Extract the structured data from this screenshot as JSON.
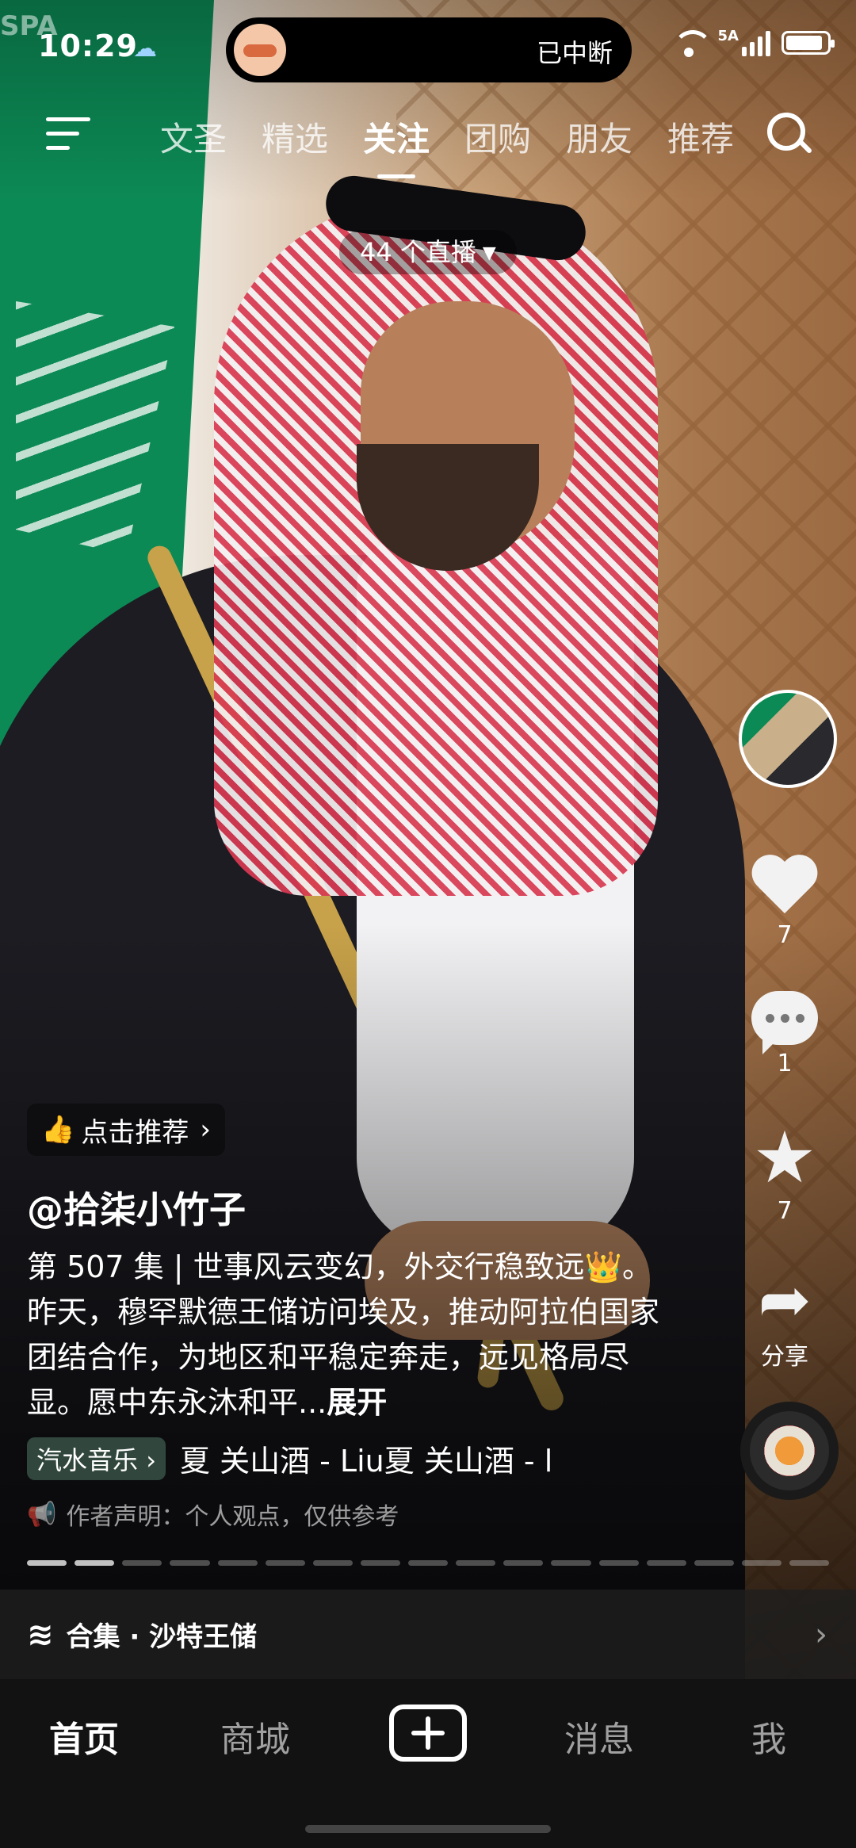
{
  "status": {
    "time": "10:29",
    "island_text": "已中断",
    "network": "5A"
  },
  "watermark": "SPA",
  "nav": {
    "tabs": [
      "文圣",
      "精选",
      "关注",
      "团购",
      "朋友",
      "推荐"
    ],
    "active_tab": "关注"
  },
  "live": {
    "label": "44 个直播"
  },
  "rail": {
    "like_count": "7",
    "comment_count": "1",
    "favorite_count": "7",
    "share_label": "分享"
  },
  "post": {
    "recommend_label": "点击推荐",
    "author": "@拾柒小竹子",
    "caption": "第 507 集 | 世事风云变幻，外交行稳致远👑。昨天，穆罕默德王储访问埃及，推动阿拉伯国家团结合作，为地区和平稳定奔走，远见格局尽显。愿中东永沐和平...",
    "expand_label": "展开",
    "music_chip": "汽水音乐",
    "music_title": "夏  关山酒 - Liu夏  关山酒 - l",
    "disclaimer": "作者声明：个人观点，仅供参考"
  },
  "collection": {
    "label": "合集 · 沙特王储"
  },
  "bottom_nav": {
    "home": "首页",
    "mall": "商城",
    "messages": "消息",
    "me": "我"
  },
  "colors": {
    "flag_green": "#0c8a55",
    "gold": "#c8a24a"
  }
}
